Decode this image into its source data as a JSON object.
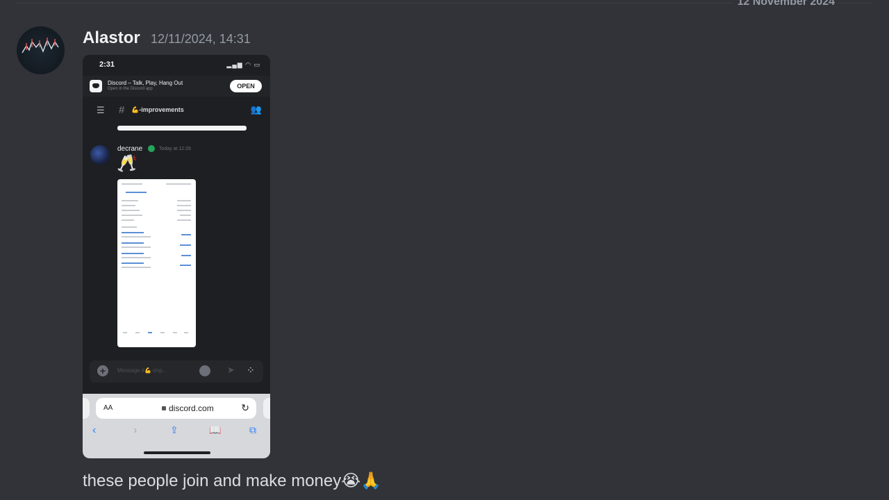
{
  "date_divider": "12 November 2024",
  "message": {
    "author": "Alastor",
    "timestamp": "12/11/2024, 14:31",
    "text": "these people join and make money",
    "text_emojis": "😭🙏"
  },
  "attachment": {
    "phone_time": "2:31",
    "status_icons": "▂▄▆ ◠ ▭",
    "banner_title": "Discord – Talk, Play, Hang Out",
    "banner_subtitle": "Open in the Discord app",
    "open_button": "OPEN",
    "channel_name": "💪-improvements",
    "inner_author": "decrane",
    "inner_timestamp": "Today at 12:26",
    "inner_emoji": "🥂",
    "composer_placeholder": "Message #💪-imp...",
    "url_prefix": "AA",
    "url": "discord.com"
  },
  "colors": {
    "background": "#313338",
    "username": "#f2f3f5",
    "muted": "#949ba4",
    "verified": "#23a55a",
    "safari_blue": "#2a7fff"
  }
}
